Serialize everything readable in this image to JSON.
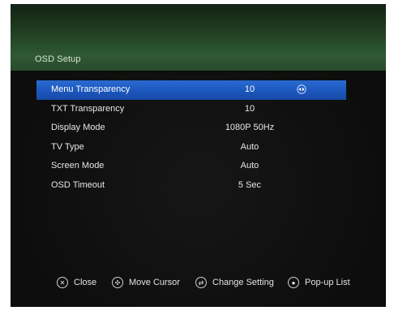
{
  "title": "OSD Setup",
  "menu": {
    "items": [
      {
        "label": "Menu Transparency",
        "value": "10",
        "selected": true
      },
      {
        "label": "TXT Transparency",
        "value": "10",
        "selected": false
      },
      {
        "label": "Display Mode",
        "value": "1080P 50Hz",
        "selected": false
      },
      {
        "label": "TV Type",
        "value": "Auto",
        "selected": false
      },
      {
        "label": "Screen Mode",
        "value": "Auto",
        "selected": false
      },
      {
        "label": "OSD Timeout",
        "value": "5 Sec",
        "selected": false
      }
    ]
  },
  "footer": {
    "close_label": "Close",
    "move_cursor_label": "Move Cursor",
    "change_setting_label": "Change Setting",
    "popup_list_label": "Pop-up List",
    "icons": [
      "exit-icon",
      "navigation-icon",
      "left-right-icon",
      "ok-icon"
    ]
  },
  "colors": {
    "highlight": "#1d58bf",
    "header_band": "#2f5a33",
    "background": "#0c0d0c",
    "text": "#e6e6e6"
  }
}
